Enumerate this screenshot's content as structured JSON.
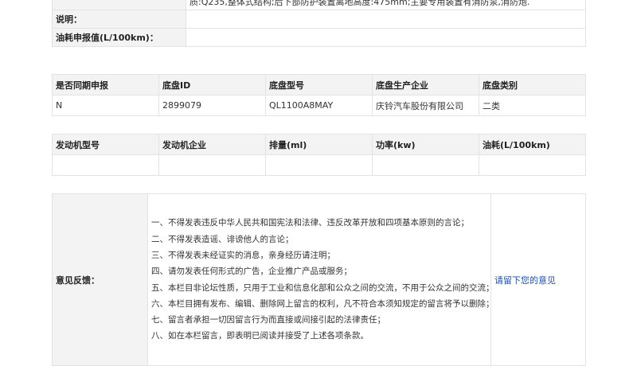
{
  "spec": {
    "top_label": "",
    "top_value": "质:Q235,整体式结构;后下部防护装置离地高度:475mm;主要专用装置有消防泵,消防炮.",
    "note_label": "说明：",
    "note_value": "",
    "fuel_label": "油耗申报值(L/100km)：",
    "fuel_value": ""
  },
  "chassis": {
    "headers": [
      "是否同期申报",
      "底盘ID",
      "底盘型号",
      "底盘生产企业",
      "底盘类别"
    ],
    "row": [
      "N",
      "2899079",
      "QL1100A8MAY",
      "庆铃汽车股份有限公司",
      "二类"
    ]
  },
  "engine": {
    "headers": [
      "发动机型号",
      "发动机企业",
      "排量(ml)",
      "功率(kw)",
      "油耗(L/100km)"
    ],
    "row": [
      "",
      "",
      "",
      "",
      ""
    ]
  },
  "feedback": {
    "label": "意见反馈：",
    "rules": [
      "一、不得发表违反中华人民共和国宪法和法律、违反改革开放和四项基本原则的言论；",
      "二、不得发表造谣、诽谤他人的言论；",
      "三、不得发表未经证实的消息，亲身经历请注明；",
      "四、请勿发表任何形式的广告，企业推广产品或服务；",
      "五、本栏目非论坛性质，只用于工业和信息化部和公众之间的交流，不用于公众之间的交流；",
      "六、本栏目拥有发布、编辑、删除网上留言的权利，凡不符合本须知规定的留言将予以删除；",
      "七、留言者承担一切因留言行为而直接或间接引起的法律责任；",
      "八、如在本栏留言，即表明已阅读并接受了上述各项条款。"
    ],
    "link": "请留下您的意见"
  },
  "colors": {
    "header_bg": "#f3f3f3",
    "border": "#e3e3e3",
    "link": "#1a4fb5"
  }
}
